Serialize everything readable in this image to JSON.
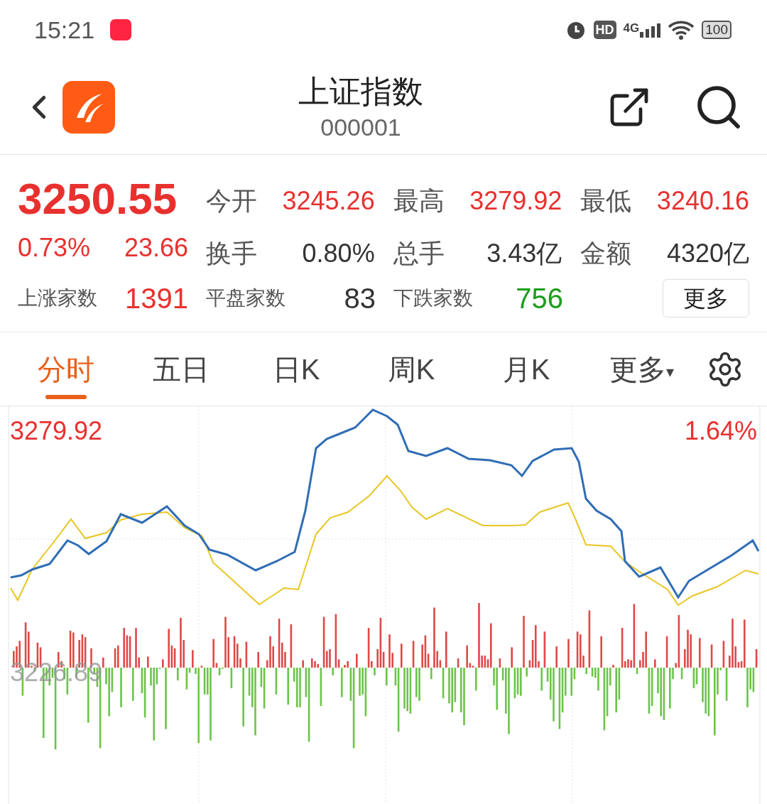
{
  "status_bar": {
    "time": "15:21",
    "hd": "HD",
    "network": "4G",
    "battery": "100"
  },
  "header": {
    "title": "上证指数",
    "code": "000001"
  },
  "quote": {
    "price": "3250.55",
    "change_pct": "0.73%",
    "change": "23.66",
    "stats": [
      {
        "label": "今开",
        "value": "3245.26",
        "color": "#e8312f"
      },
      {
        "label": "最高",
        "value": "3279.92",
        "color": "#e8312f"
      },
      {
        "label": "最低",
        "value": "3240.16",
        "color": "#e8312f"
      },
      {
        "label": "换手",
        "value": "0.80%",
        "color": "#333333"
      },
      {
        "label": "总手",
        "value": "3.43亿",
        "color": "#333333"
      },
      {
        "label": "金额",
        "value": "4320亿",
        "color": "#333333"
      }
    ],
    "breadth": [
      {
        "label": "上涨家数",
        "value": "1391",
        "color": "#e8312f"
      },
      {
        "label": "平盘家数",
        "value": "83",
        "color": "#333333"
      },
      {
        "label": "下跌家数",
        "value": "756",
        "color": "#1a9e1a"
      }
    ],
    "more_button": "更多"
  },
  "tabs": [
    {
      "label": "分时",
      "selected": true
    },
    {
      "label": "五日",
      "selected": false
    },
    {
      "label": "日K",
      "selected": false
    },
    {
      "label": "周K",
      "selected": false
    },
    {
      "label": "月K",
      "selected": false
    },
    {
      "label": "更多",
      "selected": false,
      "caret": "▾"
    }
  ],
  "chart": {
    "high_label": "3279.92",
    "pct_label": "1.64%",
    "base_label": "3226.89"
  }
}
